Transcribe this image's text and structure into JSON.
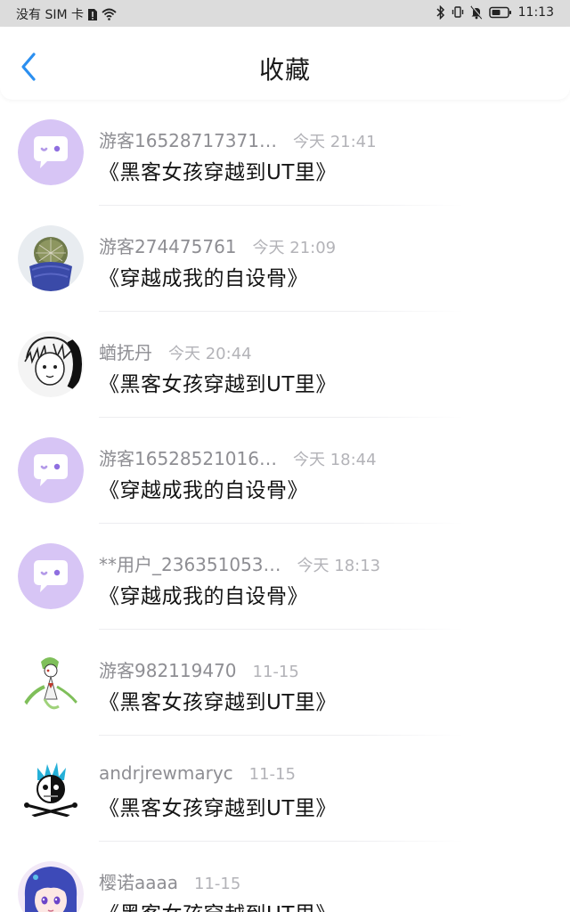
{
  "status_bar": {
    "carrier": "没有 SIM 卡",
    "time": "11:13"
  },
  "header": {
    "title": "收藏"
  },
  "items": [
    {
      "user": "游客16528717371…",
      "time": "今天 21:41",
      "book": "《黑客女孩穿越到UT里》",
      "avatar": "default"
    },
    {
      "user": "游客274475761",
      "time": "今天 21:09",
      "book": "《穿越成我的自设骨》",
      "avatar": "cactus"
    },
    {
      "user": "蝤抚丹",
      "time": "今天 20:44",
      "book": "《黑客女孩穿越到UT里》",
      "avatar": "sketch"
    },
    {
      "user": "游客16528521016…",
      "time": "今天 18:44",
      "book": "《穿越成我的自设骨》",
      "avatar": "default"
    },
    {
      "user": "**用户_236351053…",
      "time": "今天 18:13",
      "book": "《穿越成我的自设骨》",
      "avatar": "default"
    },
    {
      "user": "游客982119470",
      "time": "11-15",
      "book": "《黑客女孩穿越到UT里》",
      "avatar": "figure"
    },
    {
      "user": "andrjrewmaryc",
      "time": "11-15",
      "book": "《黑客女孩穿越到UT里》",
      "avatar": "jolly-roger"
    },
    {
      "user": "樱诺aaaa",
      "time": "11-15",
      "book": "《黑客女孩穿越到UT里》",
      "avatar": "anime"
    }
  ],
  "colors": {
    "accent": "#2b8ff0",
    "default_avatar_bg": "#d7c5f5",
    "status_bar_bg": "#dcdcdc"
  }
}
